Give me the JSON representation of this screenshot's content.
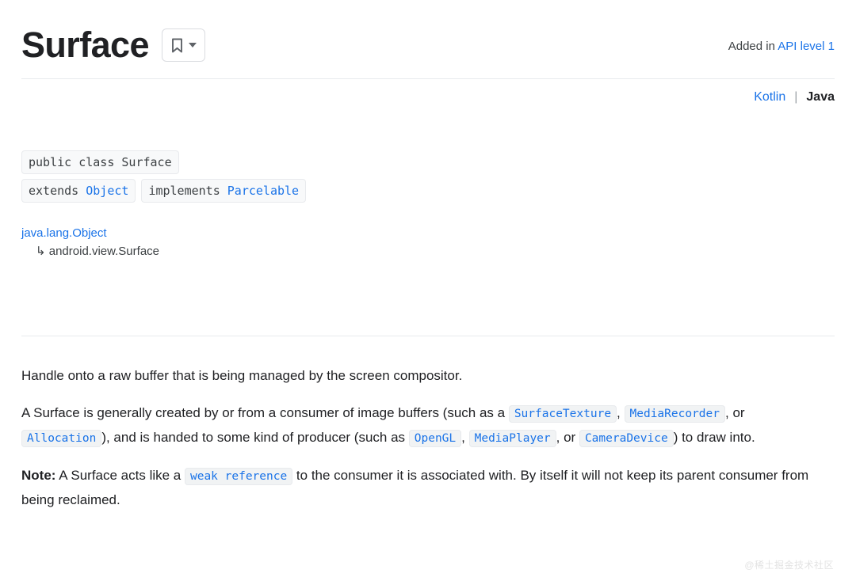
{
  "header": {
    "title": "Surface",
    "bookmark_icon": "bookmark-icon",
    "caret_icon": "chevron-down-icon",
    "added_in_prefix": "Added in ",
    "added_in_link": "API level 1"
  },
  "language_switch": {
    "kotlin": "Kotlin",
    "separator": "|",
    "java": "Java"
  },
  "signature": {
    "line1": "public class Surface",
    "line2_keyword": "extends",
    "line2_type": "Object",
    "line3_keyword": "implements",
    "line3_type": "Parcelable"
  },
  "inheritance": [
    {
      "arrow": "",
      "label": "java.lang.Object",
      "is_link": true
    },
    {
      "arrow": "↳",
      "label": "android.view.Surface",
      "is_link": false
    }
  ],
  "description": {
    "p1": "Handle onto a raw buffer that is being managed by the screen compositor.",
    "p2_a": "A Surface is generally created by or from a consumer of image buffers (such as a ",
    "p2_code1": "SurfaceTexture",
    "p2_b": ", ",
    "p2_code2": "MediaRecorder",
    "p2_c": ", or ",
    "p2_code3": "Allocation",
    "p2_d": "), and is handed to some kind of producer (such as ",
    "p2_code4": "OpenGL",
    "p2_e": ", ",
    "p2_code5": "MediaPlayer",
    "p2_f": ", or ",
    "p2_code6": "CameraDevice",
    "p2_g": ") to draw into.",
    "p3_label": "Note:",
    "p3_a": " A Surface acts like a ",
    "p3_code1": "weak reference",
    "p3_b": " to the consumer it is associated with. By itself it will not keep its parent consumer from being reclaimed."
  },
  "watermark": "@稀土掘金技术社区",
  "colors": {
    "link_blue": "#1a73e8",
    "text": "#202124",
    "divider": "#e8eaed",
    "chip_bg": "#f1f3f4"
  }
}
